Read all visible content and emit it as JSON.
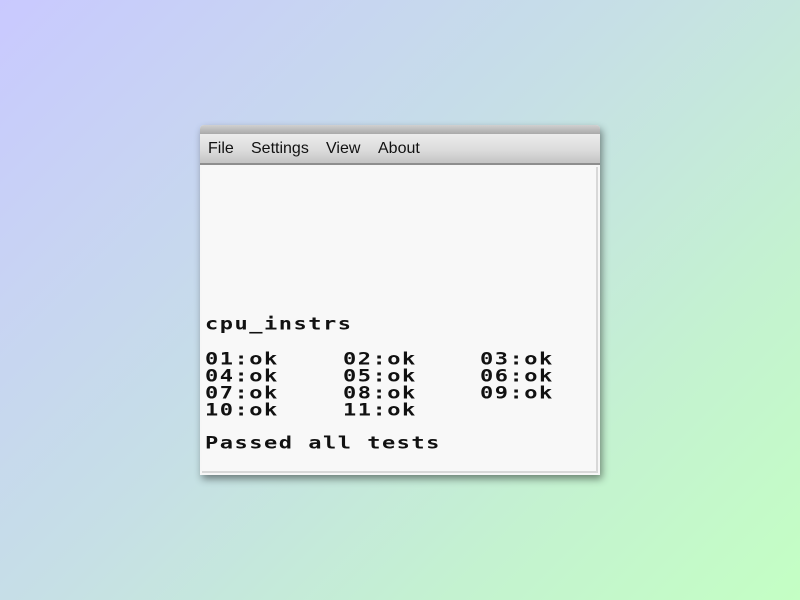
{
  "menu": {
    "items": [
      "File",
      "Settings",
      "View",
      "About"
    ]
  },
  "screen": {
    "title": "cpu_instrs",
    "results": [
      [
        "01:ok",
        "02:ok",
        "03:ok"
      ],
      [
        "04:ok",
        "05:ok",
        "06:ok"
      ],
      [
        "07:ok",
        "08:ok",
        "09:ok"
      ],
      [
        "10:ok",
        "11:ok"
      ]
    ],
    "status": "Passed all tests"
  },
  "colors": {
    "text": "#111111",
    "screen_background": "#f8f8f8"
  }
}
